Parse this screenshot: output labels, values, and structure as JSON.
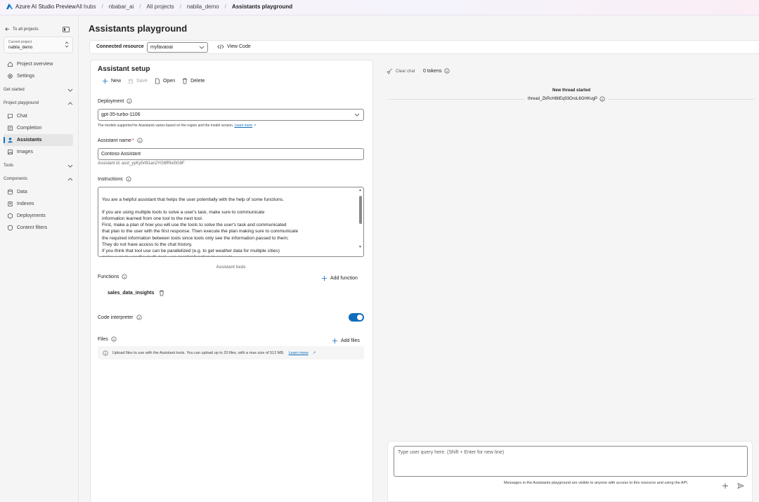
{
  "topbar": {
    "brand": "Azure AI Studio Preview",
    "breadcrumbs": [
      "All hubs",
      "nbabar_ai",
      "All projects",
      "nabila_demo",
      "Assistants playground"
    ]
  },
  "leftnav": {
    "back_label": "To all projects",
    "current_project_caption": "Current project",
    "current_project_name": "nabila_demo",
    "items_top": [
      "Project overview",
      "Settings"
    ],
    "section_get_started": "Get started",
    "section_playground": "Project playground",
    "playground_items": [
      "Chat",
      "Completion",
      "Assistants",
      "Images"
    ],
    "active_item": "Assistants",
    "section_tools": "Tools",
    "section_components": "Components",
    "component_items": [
      "Data",
      "Indexes",
      "Deployments",
      "Content filters"
    ]
  },
  "main": {
    "title": "Assistants playground",
    "connected_resource_label": "Connected resource",
    "connected_resource_value": "myfavaoai",
    "view_code_label": "View Code"
  },
  "setup": {
    "title": "Assistant setup",
    "toolbar": {
      "new": "New",
      "save": "Save",
      "open": "Open",
      "delete": "Delete"
    },
    "deployment_label": "Deployment",
    "deployment_value": "gpt-35-turbo-1106",
    "deployment_hint": "The models supported for Assistants varies based on the region and the model version.",
    "learn_more": "Learn more",
    "assistant_name_label": "Assistant name",
    "assistant_name_required": "*",
    "assistant_name_value": "Contoso Assistant",
    "assistant_id": "Assistant id: asst_yyKy5rt91an2YG6fRlxl0G8F",
    "instructions_label": "Instructions",
    "instructions_text": "You are a helpful assistant that helps the user potentially with the help of some functions.\n\nIf you are using multiple tools to solve a user's task, make sure to communicate\ninformation learned from one tool to the next tool.\nFirst, make a plan of how you will use the tools to solve the user's task and communicated\nthat plan to the user with the first response. Then execute the plan making sure to communicate\nthe required information between tools since tools only see the information passed to them;\nThey do not have access to the chat history.\nIf you think that tool use can be parallelized (e.g. to get weather data for multiple cities)\nmake sure to use the multi_tool_use.parallel function to execute.",
    "assistant_tools_label": "Assistant tools",
    "functions_label": "Functions",
    "add_function": "Add function",
    "function_name": "sales_data_insights",
    "code_interpreter_label": "Code interpreter",
    "code_interpreter_on": true,
    "files_label": "Files",
    "add_files": "Add files",
    "files_note": "Upload files to use with the Assistant tools. You can upload up to 20 files, with a max size of 512 MB."
  },
  "chat": {
    "clear_chat": "Clear chat",
    "tokens": "0 tokens",
    "thread_started": "New thread started",
    "thread_id": "thread_ZkRcH8ltEq93OroL6GHKvgP",
    "query_placeholder": "Type user query here. (Shift + Enter for new line)",
    "notice": "Messages in the Assistants playground are visible to anyone with access to this resource and using the API."
  },
  "colors": {
    "accent": "#0f6cbd",
    "required": "#c50f1f"
  },
  "icons": [
    "azure-logo-icon",
    "back-arrow-icon",
    "panel-icon",
    "home-icon",
    "gear-icon",
    "chat-icon",
    "completion-icon",
    "assistant-icon",
    "image-icon",
    "data-icon",
    "index-icon",
    "deployment-icon",
    "shield-icon",
    "code-icon",
    "plus-icon",
    "save-icon",
    "open-icon",
    "delete-icon",
    "info-icon",
    "broom-icon",
    "send-icon"
  ]
}
